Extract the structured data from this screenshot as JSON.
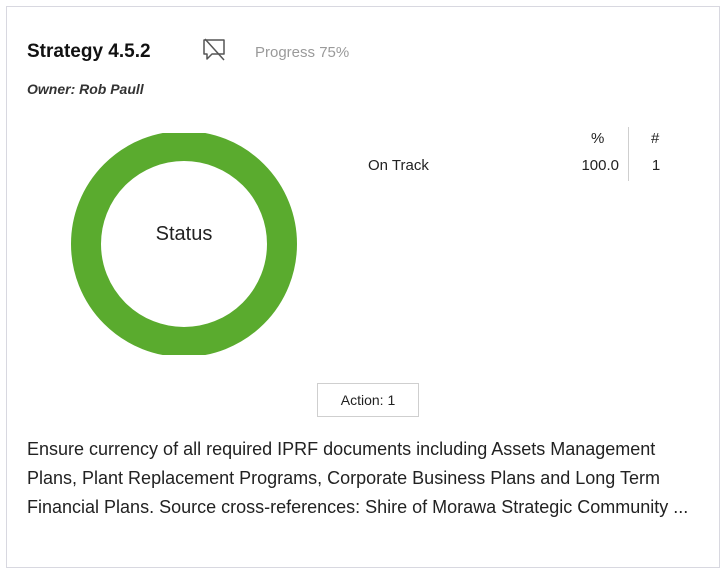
{
  "card": {
    "title": "Strategy 4.5.2",
    "progress": "Progress 75%",
    "owner": "Owner: Rob Paull",
    "comment_icon": "comment-off-icon"
  },
  "status": {
    "label": "Status",
    "color": "#5aab2e",
    "segments": [
      {
        "name": "On Track",
        "percent": 100.0,
        "count": 1
      }
    ]
  },
  "table": {
    "headers": {
      "percent": "%",
      "count": "#"
    },
    "rows": [
      {
        "label": "On Track",
        "percent": "100.0",
        "count": "1"
      }
    ]
  },
  "action_button": "Action: 1",
  "description": "Ensure currency of all required IPRF documents including Assets Management Plans, Plant Replacement Programs, Corporate Business Plans and Long Term Financial Plans. Source cross-references: Shire of Morawa Strategic Community ..."
}
